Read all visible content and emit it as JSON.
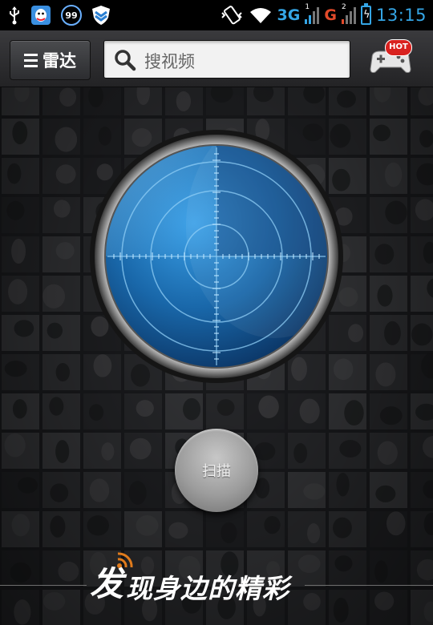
{
  "status_bar": {
    "time": "13:15",
    "network_3g": "3G",
    "network_g": "G",
    "badge_count": "99",
    "sim1_index": "1",
    "sim2_index": "2",
    "icons": [
      "usb-icon",
      "qq-icon",
      "notification-99-icon",
      "shield-icon",
      "vibrate-icon",
      "wifi-icon",
      "signal-icon",
      "battery-charging-icon"
    ]
  },
  "appbar": {
    "radar_tab_label": "雷达",
    "search_placeholder": "搜视频",
    "hot_badge": "HOT"
  },
  "main": {
    "scan_button_label": "扫描",
    "slogan_first": "发",
    "slogan_rest": "现身边的精彩"
  },
  "colors": {
    "accent_blue": "#35a6e6",
    "radar_blue": "#1d7bc0",
    "hot_red": "#d9221f",
    "signal_red": "#e24a2a"
  }
}
